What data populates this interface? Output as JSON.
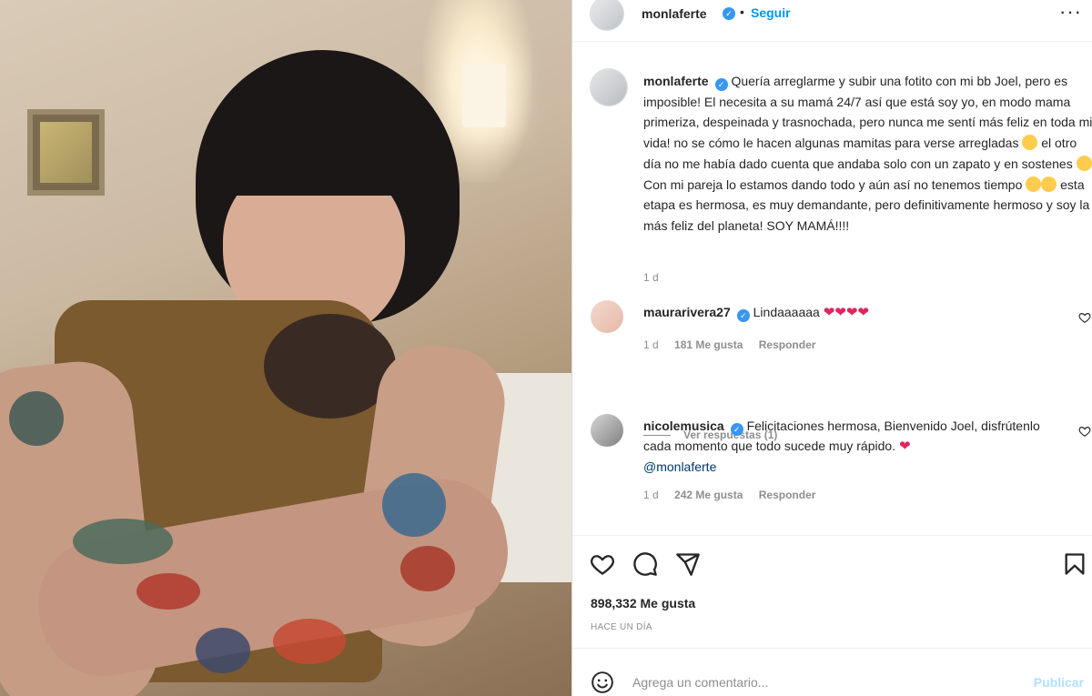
{
  "post": {
    "author": "monlaferte",
    "follow_label": "Seguir",
    "dot": "•",
    "more": "···"
  },
  "caption": {
    "username": "monlaferte",
    "text_a": "Quería arreglarme y subir una fotito con mi bb Joel, pero es imposible! El necesita a su mamá 24/7 así que está soy yo, en modo mama primeriza, despeinada y trasnochada, pero nunca me sentí más feliz en toda mi vida! no se cómo le hacen algunas mamitas para verse arregladas ",
    "text_b": " el otro día no me había dado cuenta que andaba solo con un zapato y en sostenes ",
    "text_c": " Con mi pareja lo estamos dando todo y aún así no tenemos tiempo ",
    "text_d": " esta etapa es hermosa, es muy demandante, pero definitivamente hermoso y soy la más feliz del planeta! SOY MAMÁ!!!!",
    "time": "1 d"
  },
  "comments": [
    {
      "username": "maurarivera27",
      "text": "Lindaaaaaa",
      "hearts": "❤❤❤❤",
      "time": "1 d",
      "likes": "181 Me gusta",
      "reply": "Responder"
    },
    {
      "username": "nicolemusica",
      "text": "Felicitaciones hermosa, Bienvenido Joel, disfrútenlo cada momento que todo sucede muy rápido. ",
      "heart": "❤",
      "mention": "@monlaferte",
      "time": "1 d",
      "likes": "242 Me gusta",
      "reply": "Responder"
    }
  ],
  "view_replies": "Ver respuestas (1)",
  "likes_count": "898,332 Me gusta",
  "time_ago": "HACE UN DÍA",
  "add_comment": {
    "placeholder": "Agrega un comentario...",
    "publish": "Publicar"
  },
  "colors": {
    "link_blue": "#0095f6",
    "verified_blue": "#3897f0",
    "heart_red": "#e0245e",
    "muted": "#8e8e8e"
  },
  "icons": [
    "heart-icon",
    "comment-icon",
    "share-icon",
    "bookmark-icon",
    "smile-icon",
    "verified-icon",
    "more-icon"
  ]
}
